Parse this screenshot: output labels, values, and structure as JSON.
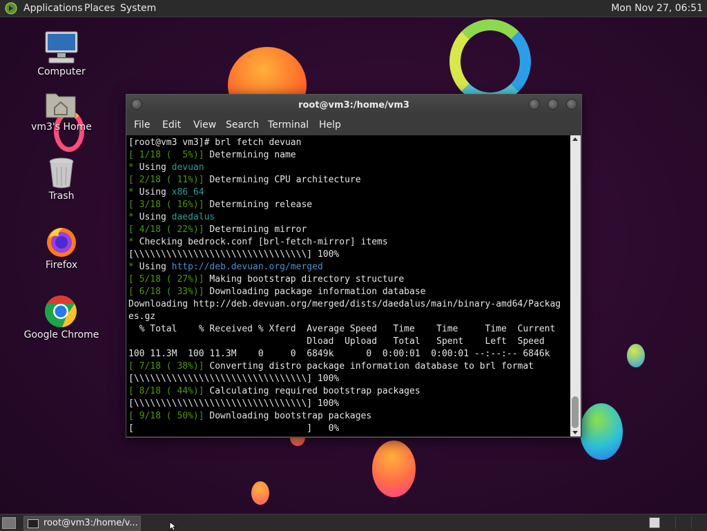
{
  "top_panel": {
    "menu": [
      "Applications",
      "Places",
      "System"
    ],
    "clock": "Mon Nov 27, 06:51"
  },
  "desktop_icons": [
    {
      "label": "Computer",
      "icon": "computer-icon"
    },
    {
      "label": "vm3's Home",
      "icon": "home-folder-icon"
    },
    {
      "label": "Trash",
      "icon": "trash-icon"
    },
    {
      "label": "Firefox",
      "icon": "firefox-icon"
    },
    {
      "label": "Google Chrome",
      "icon": "chrome-icon"
    }
  ],
  "terminal": {
    "title": "root@vm3:/home/vm3",
    "menu": [
      "File",
      "Edit",
      "View",
      "Search",
      "Terminal",
      "Help"
    ],
    "lines": [
      [
        {
          "t": "[root@vm3 vm3]# brl fetch devuan"
        }
      ],
      [
        {
          "t": "[ 1/18 (  5%)]",
          "c": "g"
        },
        {
          "t": " Determining name"
        }
      ],
      [
        {
          "t": "*",
          "c": "g"
        },
        {
          "t": " Using "
        },
        {
          "t": "devuan",
          "c": "c"
        }
      ],
      [
        {
          "t": "[ 2/18 ( 11%)]",
          "c": "g"
        },
        {
          "t": " Determining CPU architecture"
        }
      ],
      [
        {
          "t": "*",
          "c": "g"
        },
        {
          "t": " Using "
        },
        {
          "t": "x86_64",
          "c": "c"
        }
      ],
      [
        {
          "t": "[ 3/18 ( 16%)]",
          "c": "g"
        },
        {
          "t": " Determining release"
        }
      ],
      [
        {
          "t": "*",
          "c": "g"
        },
        {
          "t": " Using "
        },
        {
          "t": "daedalus",
          "c": "c"
        }
      ],
      [
        {
          "t": "[ 4/18 ( 22%)]",
          "c": "g"
        },
        {
          "t": " Determining mirror"
        }
      ],
      [
        {
          "t": "*",
          "c": "g"
        },
        {
          "t": " Checking bedrock.conf [brl-fetch-mirror] items"
        }
      ],
      [
        {
          "t": "[\\\\\\\\\\\\\\\\\\\\\\\\\\\\\\\\\\\\\\\\\\\\\\\\\\\\\\\\\\\\\\\\] 100%"
        }
      ],
      [
        {
          "t": "*",
          "c": "g"
        },
        {
          "t": " Using "
        },
        {
          "t": "http://deb.devuan.org/merged",
          "c": "b"
        }
      ],
      [
        {
          "t": "[ 5/18 ( 27%)]",
          "c": "g"
        },
        {
          "t": " Making bootstrap directory structure"
        }
      ],
      [
        {
          "t": "[ 6/18 ( 33%)]",
          "c": "g"
        },
        {
          "t": " Downloading package information database"
        }
      ],
      [
        {
          "t": "Downloading http://deb.devuan.org/merged/dists/daedalus/main/binary-amd64/Packag"
        }
      ],
      [
        {
          "t": "es.gz"
        }
      ],
      [
        {
          "t": "  % Total    % Received % Xferd  Average Speed   Time    Time     Time  Current"
        }
      ],
      [
        {
          "t": "                                 Dload  Upload   Total   Spent    Left  Speed"
        }
      ],
      [
        {
          "t": "100 11.3M  100 11.3M    0     0  6849k      0  0:00:01  0:00:01 --:--:-- 6846k"
        }
      ],
      [
        {
          "t": "[ 7/18 ( 38%)]",
          "c": "g"
        },
        {
          "t": " Converting distro package information database to brl format"
        }
      ],
      [
        {
          "t": "[\\\\\\\\\\\\\\\\\\\\\\\\\\\\\\\\\\\\\\\\\\\\\\\\\\\\\\\\\\\\\\\\] 100%"
        }
      ],
      [
        {
          "t": "[ 8/18 ( 44%)]",
          "c": "g"
        },
        {
          "t": " Calculating required bootstrap packages"
        }
      ],
      [
        {
          "t": "[\\\\\\\\\\\\\\\\\\\\\\\\\\\\\\\\\\\\\\\\\\\\\\\\\\\\\\\\\\\\\\\\] 100%"
        }
      ],
      [
        {
          "t": "[ 9/18 ( 50%)]",
          "c": "g"
        },
        {
          "t": " Downloading bootstrap packages"
        }
      ],
      [
        {
          "t": "[                                ]   0%"
        }
      ]
    ]
  },
  "taskbar": {
    "task_label": "root@vm3:/home/v..."
  }
}
